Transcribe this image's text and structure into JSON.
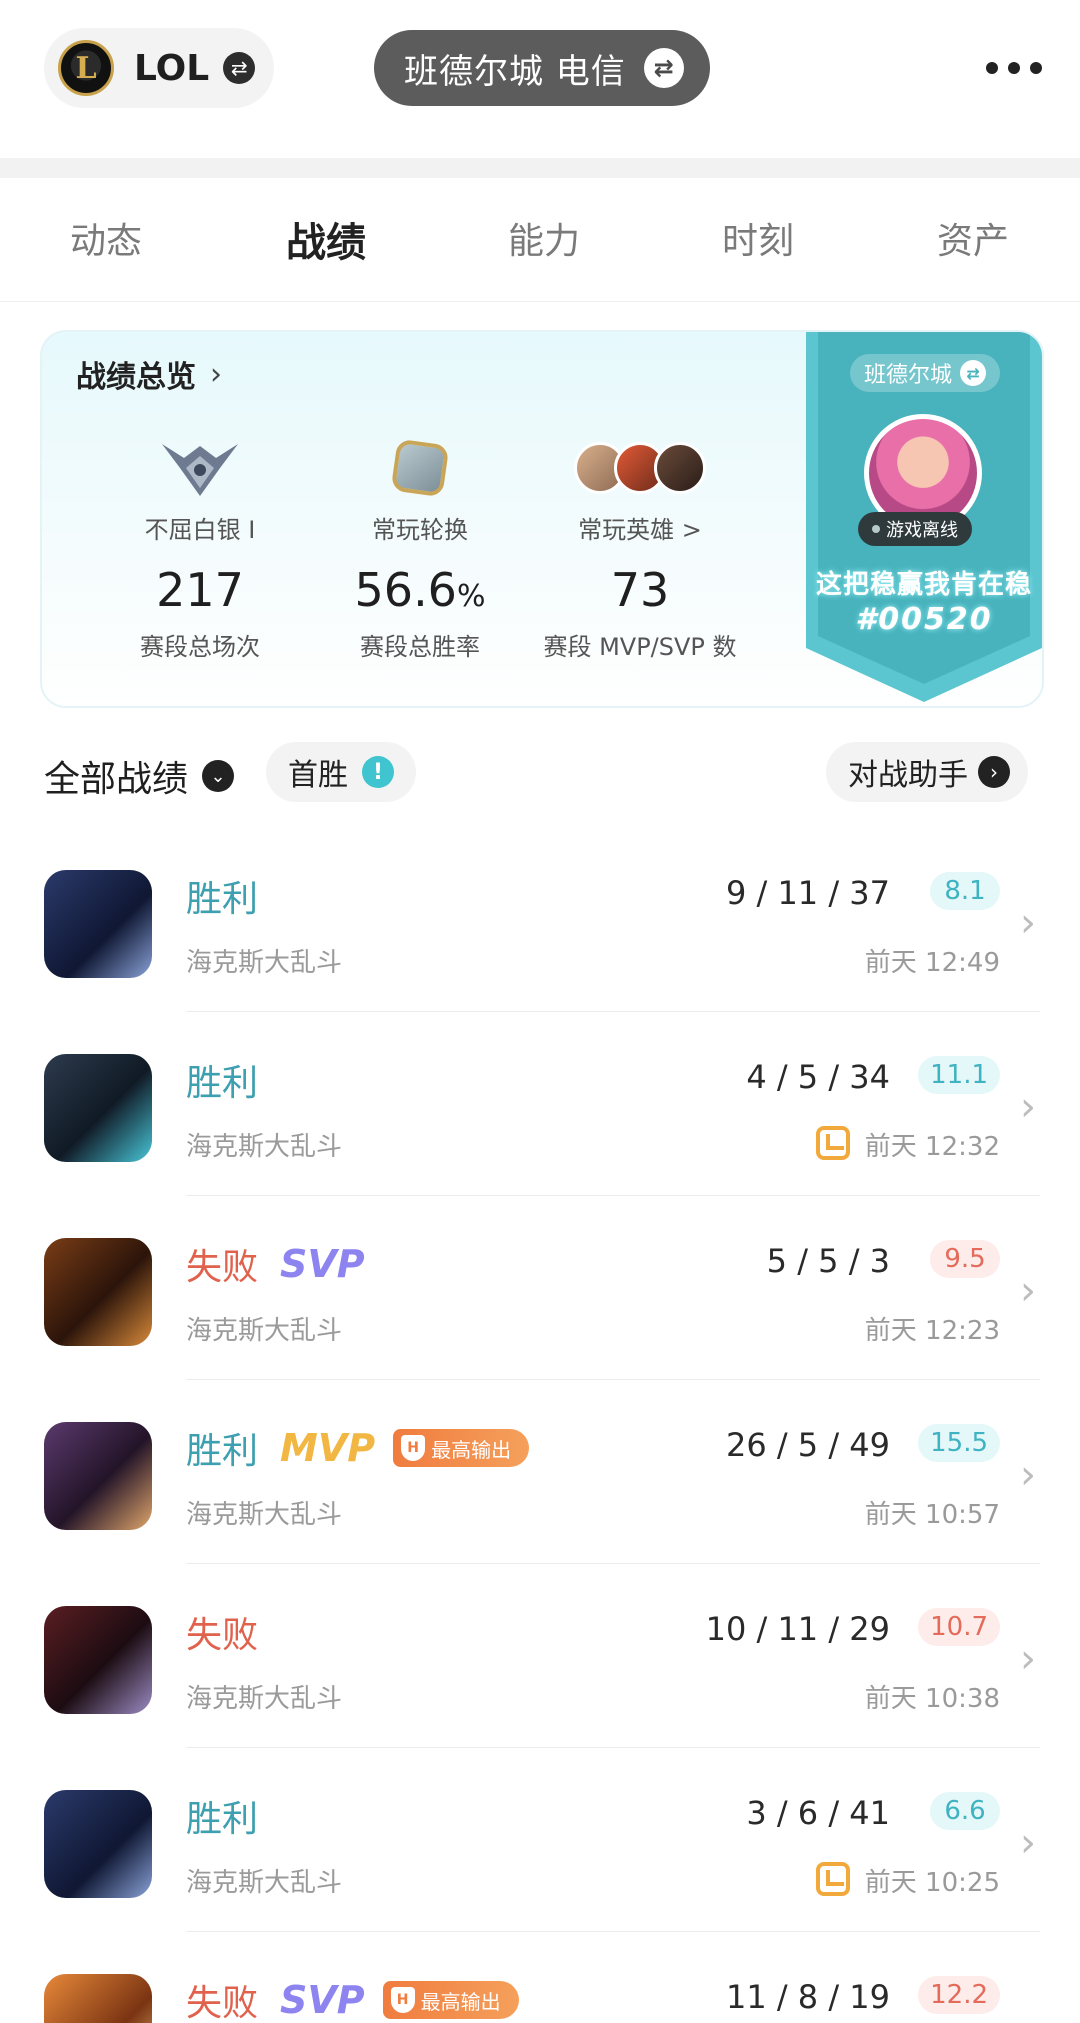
{
  "topbar": {
    "game_logo": "L",
    "game_name": "LOL",
    "server_name": "班德尔城 电信"
  },
  "tabs": [
    {
      "label": "动态",
      "active": false
    },
    {
      "label": "战绩",
      "active": true
    },
    {
      "label": "能力",
      "active": false
    },
    {
      "label": "时刻",
      "active": false
    },
    {
      "label": "资产",
      "active": false
    }
  ],
  "overview": {
    "title": "战绩总览",
    "stats": [
      {
        "label": "不屈白银 I",
        "value": "217",
        "unit": "",
        "sub": "赛段总场次",
        "icon": "rank-silver-emblem"
      },
      {
        "label": "常玩轮换",
        "value": "56.6",
        "unit": "%",
        "sub": "赛段总胜率",
        "icon": "rotation-mode-icon"
      },
      {
        "label": "常玩英雄 >",
        "value": "73",
        "unit": "",
        "sub": "赛段 MVP/SVP 数",
        "icon": "champion-avatars"
      }
    ],
    "banner": {
      "city": "班德尔城",
      "status": "游戏离线",
      "slogan": "这把稳赢我肯在稳",
      "code": "#00520",
      "color": "#48b3bd"
    }
  },
  "filters": {
    "all_label": "全部战绩",
    "first_win_label": "首胜",
    "helper_label": "对战助手"
  },
  "matches": [
    {
      "result": "胜利",
      "mode": "海克斯大乱斗",
      "kda": "9 / 11 / 37",
      "score": "8.1",
      "time": "前天 12:49",
      "badge": "",
      "tag": "",
      "clip": false
    },
    {
      "result": "胜利",
      "mode": "海克斯大乱斗",
      "kda": "4 / 5 / 34",
      "score": "11.1",
      "time": "前天 12:32",
      "badge": "",
      "tag": "",
      "clip": true
    },
    {
      "result": "失败",
      "mode": "海克斯大乱斗",
      "kda": "5 / 5 / 3",
      "score": "9.5",
      "time": "前天 12:23",
      "badge": "SVP",
      "tag": "",
      "clip": false
    },
    {
      "result": "胜利",
      "mode": "海克斯大乱斗",
      "kda": "26 / 5 / 49",
      "score": "15.5",
      "time": "前天 10:57",
      "badge": "MVP",
      "tag": "最高输出",
      "clip": false
    },
    {
      "result": "失败",
      "mode": "海克斯大乱斗",
      "kda": "10 / 11 / 29",
      "score": "10.7",
      "time": "前天 10:38",
      "badge": "",
      "tag": "",
      "clip": false
    },
    {
      "result": "胜利",
      "mode": "海克斯大乱斗",
      "kda": "3 / 6 / 41",
      "score": "6.6",
      "time": "前天 10:25",
      "badge": "",
      "tag": "",
      "clip": true
    },
    {
      "result": "失败",
      "mode": "",
      "kda": "11 / 8 / 19",
      "score": "12.2",
      "time": "",
      "badge": "SVP",
      "tag": "最高输出",
      "clip": false
    }
  ],
  "colors": {
    "win": "#3e9fb0",
    "loss": "#e0624d",
    "mvp": "#f2b743",
    "svp": "#8d84f0",
    "accent": "#3fc4d0"
  }
}
